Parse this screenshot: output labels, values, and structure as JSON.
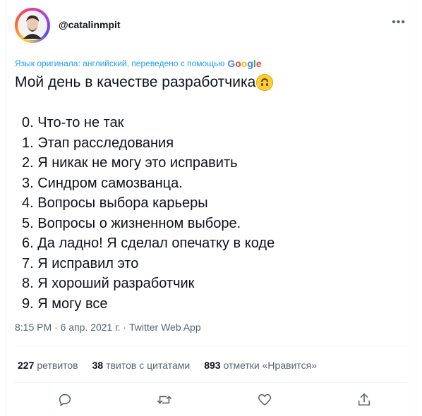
{
  "author": {
    "handle": "@catalinmpit"
  },
  "translation": {
    "note": "Язык оригинала: английский, переведено с помощью",
    "provider_letters": [
      "G",
      "o",
      "o",
      "g",
      "l",
      "e"
    ]
  },
  "tweet": {
    "title": "Мой день в качестве разработчика",
    "emoji_icon": "upside-down-face-emoji",
    "items": [
      "0. Что-то не так",
      "1. Этап расследования",
      "2. Я никак не могу это исправить",
      "3. Синдром самозванца.",
      "4. Вопросы выбора карьеры",
      "5. Вопросы о жизненном выборе.",
      "6. Да ладно! Я сделал опечатку в коде",
      "7. Я исправил это",
      "8. Я хороший разработчик",
      "9. Я могу все"
    ],
    "timestamp": "8:15 PM · 6 апр. 2021 г. · Twitter Web App"
  },
  "stats": {
    "retweets": {
      "count": "227",
      "label": "ретвитов"
    },
    "quotes": {
      "count": "38",
      "label": "твитов с цитатами"
    },
    "likes": {
      "count": "893",
      "label": "отметки «Нравится»"
    }
  },
  "actions": {
    "icons": [
      "reply-icon",
      "retweet-icon",
      "like-icon",
      "share-icon"
    ]
  },
  "colors": {
    "link": "#1d9bf0",
    "secondary_text": "#536471",
    "primary_text": "#0f1419",
    "divider": "#eff3f4"
  }
}
